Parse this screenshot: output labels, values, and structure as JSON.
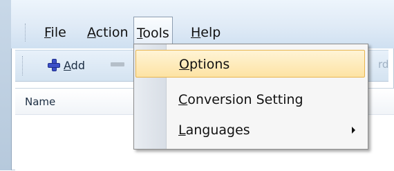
{
  "menubar": {
    "items": [
      {
        "label_hot": "F",
        "label_rest": "ile"
      },
      {
        "label_hot": "A",
        "label_rest": "ction"
      },
      {
        "label_hot": "T",
        "label_rest": "ools"
      },
      {
        "label_hot": "H",
        "label_rest": "elp"
      }
    ]
  },
  "toolbar": {
    "add_hot": "A",
    "add_rest": "dd",
    "faded_text": "rd"
  },
  "list": {
    "column_name": "Name"
  },
  "tools_menu": {
    "items": [
      {
        "hot": "O",
        "rest": "ptions"
      },
      {
        "hot": "C",
        "rest": "onversion Setting"
      },
      {
        "hot": "L",
        "rest": "anguages"
      }
    ]
  }
}
